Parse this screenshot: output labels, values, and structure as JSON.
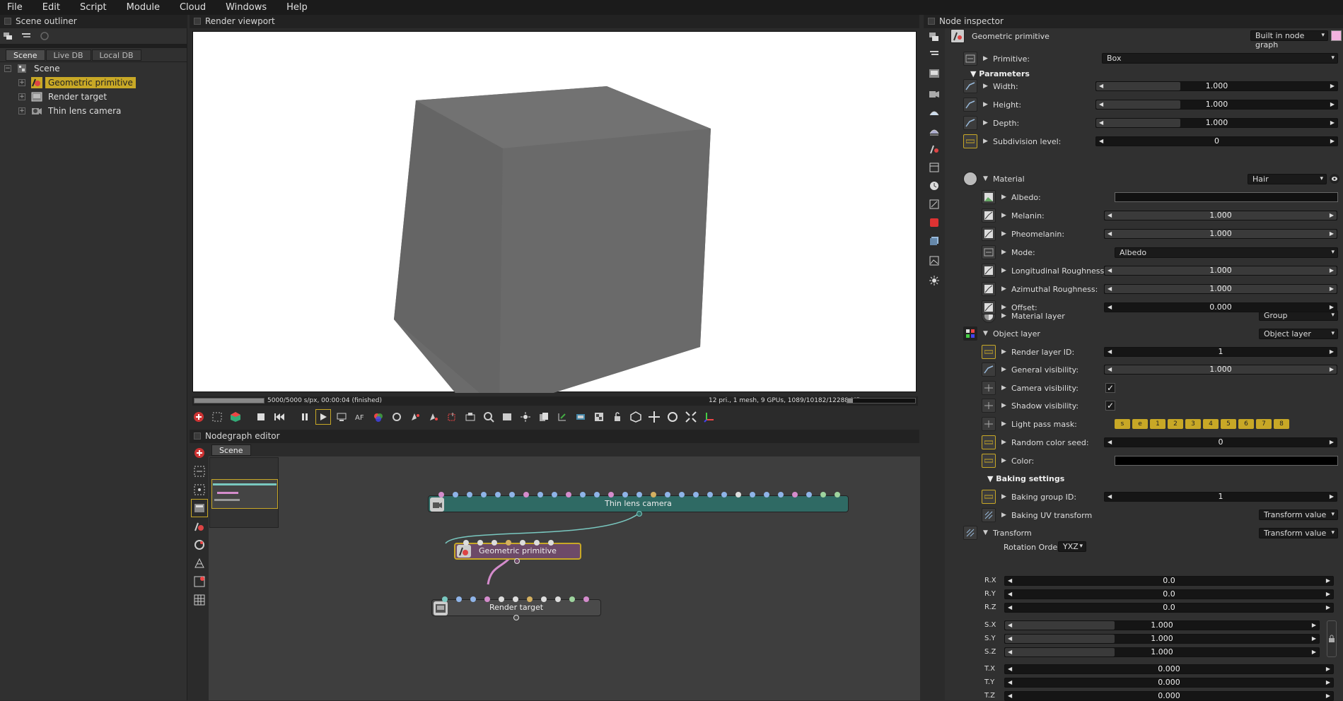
{
  "menu": [
    "File",
    "Edit",
    "Script",
    "Module",
    "Cloud",
    "Windows",
    "Help"
  ],
  "outliner": {
    "title": "Scene outliner",
    "tabs": [
      "Scene",
      "Live DB",
      "Local DB"
    ],
    "root": "Scene",
    "items": [
      "Geometric primitive",
      "Render target",
      "Thin lens camera"
    ]
  },
  "viewport": {
    "title": "Render viewport",
    "status_left": "5000/5000 s/px, 00:00:04 (finished)",
    "status_right": "12 pri., 1 mesh, 9 GPUs, 1089/10182/12288 MB",
    "progress": 1.0,
    "cube_color": "#6e6e6e"
  },
  "nodegraph": {
    "title": "Nodegraph editor",
    "tab": "Scene",
    "nodes": {
      "camera": "Thin lens camera",
      "geo": "Geometric primitive",
      "render": "Render target"
    },
    "colors": {
      "camera": "#2f6a64",
      "geo": "#6d4a68",
      "render": "#4a4a4a",
      "link_camera": "#79c8c0",
      "link_geo": "#d48ccc"
    }
  },
  "inspector": {
    "title": "Node inspector",
    "node_name": "Geometric primitive",
    "graph_mode": "Built in node graph",
    "primitive_label": "Primitive:",
    "primitive_value": "Box",
    "parameters_label": "Parameters",
    "params": [
      {
        "label": "Width:",
        "value": "1.000"
      },
      {
        "label": "Height:",
        "value": "1.000"
      },
      {
        "label": "Depth:",
        "value": "1.000"
      },
      {
        "label": "Subdivision level:",
        "value": "0"
      }
    ],
    "material": {
      "label": "Material",
      "type": "Hair",
      "rows": [
        {
          "label": "Albedo:",
          "kind": "swatch"
        },
        {
          "label": "Melanin:",
          "value": "1.000"
        },
        {
          "label": "Pheomelanin:",
          "value": "1.000"
        },
        {
          "label": "Mode:",
          "kind": "combo",
          "value": "Albedo"
        },
        {
          "label": "Longitudinal Roughness:",
          "value": "1.000"
        },
        {
          "label": "Azimuthal Roughness:",
          "value": "1.000"
        },
        {
          "label": "Offset:",
          "value": "0.000"
        }
      ],
      "layer_label": "Material layer",
      "layer_value": "Group"
    },
    "object_layer": {
      "label": "Object layer",
      "value": "Object layer",
      "render_layer_label": "Render layer ID:",
      "render_layer_value": "1",
      "general_vis_label": "General visibility:",
      "general_vis_value": "1.000",
      "camera_vis_label": "Camera visibility:",
      "shadow_vis_label": "Shadow visibility:",
      "light_mask_label": "Light pass mask:",
      "light_mask": [
        "s",
        "e",
        "1",
        "2",
        "3",
        "4",
        "5",
        "6",
        "7",
        "8"
      ],
      "seed_label": "Random color seed:",
      "seed_value": "0",
      "color_label": "Color:"
    },
    "baking": {
      "label": "Baking settings",
      "group_label": "Baking group ID:",
      "group_value": "1",
      "uv_label": "Baking UV transform",
      "uv_value": "Transform value"
    },
    "transform": {
      "label": "Transform",
      "value": "Transform value",
      "rotation_order_label": "Rotation Order",
      "rotation_order": "YXZ",
      "rows": [
        {
          "label": "R.X",
          "value": "0.0"
        },
        {
          "label": "R.Y",
          "value": "0.0"
        },
        {
          "label": "R.Z",
          "value": "0.0"
        },
        {
          "label": "S.X",
          "value": "1.000"
        },
        {
          "label": "S.Y",
          "value": "1.000"
        },
        {
          "label": "S.Z",
          "value": "1.000"
        },
        {
          "label": "T.X",
          "value": "0.000"
        },
        {
          "label": "T.Y",
          "value": "0.000"
        },
        {
          "label": "T.Z",
          "value": "0.000"
        }
      ]
    },
    "accent": "#c8a826"
  }
}
